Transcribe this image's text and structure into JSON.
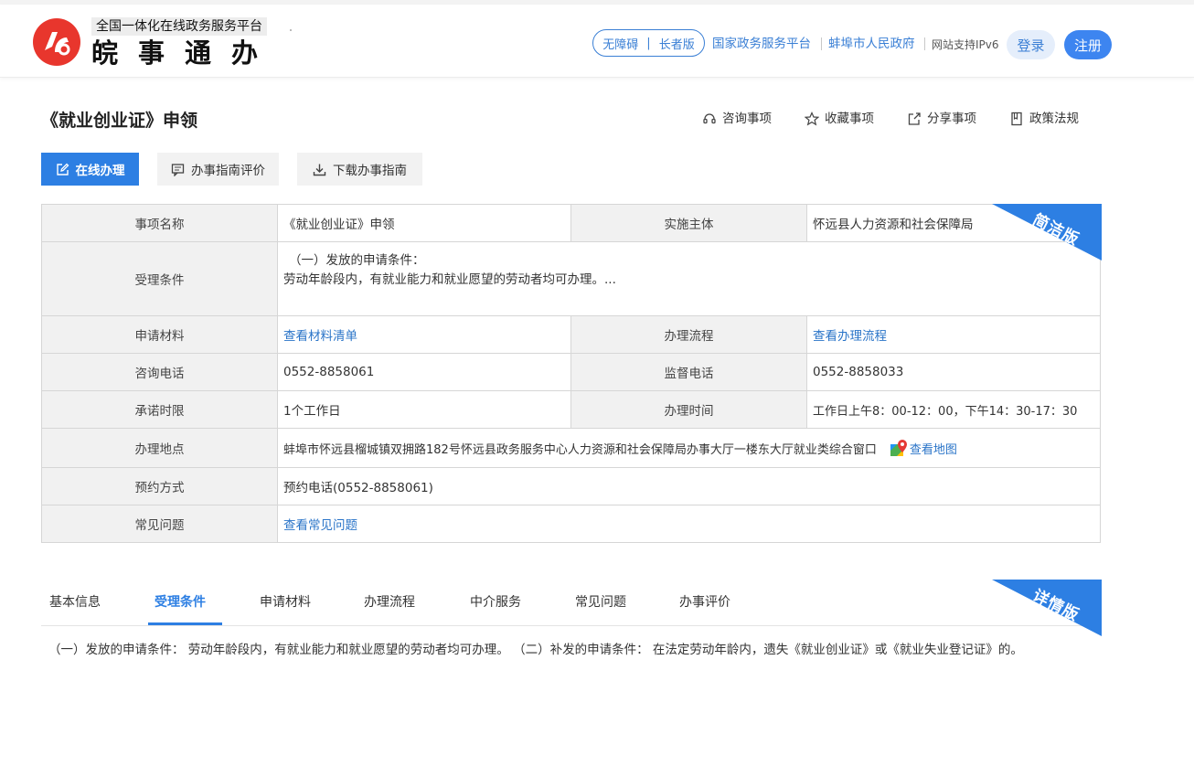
{
  "header": {
    "platform_subtitle": "全国一体化在线政务服务平台",
    "brand_name": "皖事通办",
    "accessibility_label": "无障碍",
    "elder_mode_label": "长者版",
    "pill_separator": "|",
    "national_platform_link": "国家政务服务平台",
    "city_gov_link": "蚌埠市人民政府",
    "ipv6_text": "网站支持IPv6",
    "login_label": "登录",
    "register_label": "注册",
    "logo_color": "#e8362d"
  },
  "title_bar": {
    "title": "《就业创业证》申领",
    "actions": {
      "consult": "咨询事项",
      "favorite": "收藏事项",
      "share": "分享事项",
      "policy": "政策法规"
    }
  },
  "buttons": {
    "online": "在线办理",
    "evaluate": "办事指南评价",
    "download": "下载办事指南"
  },
  "summary_table": {
    "ribbon": "简洁版",
    "item_name_label": "事项名称",
    "item_name_value": "《就业创业证》申领",
    "entity_label": "实施主体",
    "entity_value": "怀远县人力资源和社会保障局",
    "conditions_label": "受理条件",
    "conditions_line1": "（一）发放的申请条件：",
    "conditions_line2": "劳动年龄段内，有就业能力和就业愿望的劳动者均可办理。...",
    "materials_label": "申请材料",
    "materials_link": "查看材料清单",
    "process_label": "办理流程",
    "process_link": "查看办理流程",
    "consult_phone_label": "咨询电话",
    "consult_phone_value": "0552-8858061",
    "supervise_phone_label": "监督电话",
    "supervise_phone_value": "0552-8858033",
    "promise_label": "承诺时限",
    "promise_value": "1个工作日",
    "hours_label": "办理时间",
    "hours_value": "工作日上午8：00-12：00，下午14：30-17：30",
    "address_label": "办理地点",
    "address_value": "蚌埠市怀远县榴城镇双拥路182号怀远县政务服务中心人力资源和社会保障局办事大厅一楼东大厅就业类综合窗口",
    "map_link": "查看地图",
    "booking_label": "预约方式",
    "booking_value": "预约电话(0552-8858061)",
    "faq_label": "常见问题",
    "faq_link": "查看常见问题"
  },
  "detail": {
    "ribbon": "详情版",
    "tabs": [
      "基本信息",
      "受理条件",
      "申请材料",
      "办理流程",
      "中介服务",
      "常见问题",
      "办事评价"
    ],
    "active_tab": "受理条件",
    "content": "（一）发放的申请条件： 劳动年龄段内，有就业能力和就业愿望的劳动者均可办理。 （二）补发的申请条件： 在法定劳动年龄内，遗失《就业创业证》或《就业失业登记证》的。"
  },
  "colors": {
    "primary": "#2d7fe3",
    "link": "#2a74c8"
  }
}
